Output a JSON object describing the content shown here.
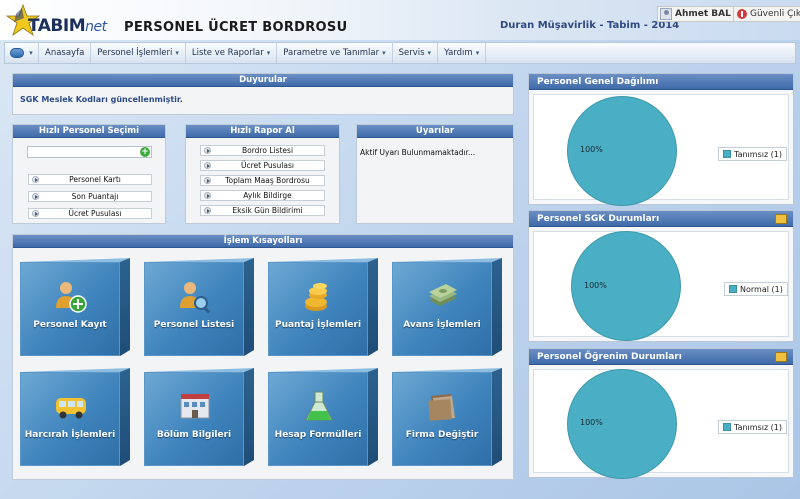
{
  "header": {
    "logo_main": "TABIM",
    "logo_suffix": "net",
    "app_title": "PERSONEL ÜCRET BORDROSU",
    "company": "Duran Müşavirlik - Tabim - 2014",
    "user_name": "Ahmet BAL",
    "logout_label": "Güvenli Çıkış"
  },
  "menu": {
    "items": [
      {
        "label": "Anasayfa",
        "has_caret": false
      },
      {
        "label": "Personel İşlemleri",
        "has_caret": true
      },
      {
        "label": "Liste ve Raporlar",
        "has_caret": true
      },
      {
        "label": "Parametre ve Tanımlar",
        "has_caret": true
      },
      {
        "label": "Servis",
        "has_caret": true
      },
      {
        "label": "Yardım",
        "has_caret": true
      }
    ]
  },
  "announcements": {
    "title": "Duyurular",
    "text": "SGK Meslek Kodları güncellenmiştir."
  },
  "quick_personnel": {
    "title": "Hızlı Personel Seçimi",
    "search_value": "",
    "links": [
      "Personel Kartı",
      "Son Puantajı",
      "Ücret Pusulası"
    ]
  },
  "quick_report": {
    "title": "Hızlı Rapor Al",
    "links": [
      "Bordro Listesi",
      "Ücret Pusulası",
      "Toplam Maaş Bordrosu",
      "Aylık Bildirge",
      "Eksik Gün Bildirimi"
    ]
  },
  "warnings": {
    "title": "Uyarılar",
    "text": "Aktif Uyarı Bulunmamaktadır..."
  },
  "shortcuts": {
    "title": "İşlem Kısayolları",
    "tiles": [
      {
        "label": "Personel Kayıt",
        "icon": "add-user-icon"
      },
      {
        "label": "Personel Listesi",
        "icon": "user-search-icon"
      },
      {
        "label": "Puantaj İşlemleri",
        "icon": "coins-icon"
      },
      {
        "label": "Avans İşlemleri",
        "icon": "money-icon"
      },
      {
        "label": "Harcırah İşlemleri",
        "icon": "van-icon"
      },
      {
        "label": "Bölüm Bilgileri",
        "icon": "building-icon"
      },
      {
        "label": "Hesap Formülleri",
        "icon": "flask-icon"
      },
      {
        "label": "Firma Değiştir",
        "icon": "folder-icon"
      }
    ]
  },
  "charts": {
    "general": {
      "title": "Personel Genel Dağılımı",
      "slice_label": "100%",
      "legend": "Tanımsız (1)"
    },
    "sgk": {
      "title": "Personel SGK Durumları",
      "slice_label": "100%",
      "legend": "Normal (1)"
    },
    "education": {
      "title": "Personel Öğrenim Durumları",
      "slice_label": "100%",
      "legend": "Tanımsız (1)"
    }
  },
  "chart_data": [
    {
      "type": "pie",
      "title": "Personel Genel Dağılımı",
      "categories": [
        "Tanımsız"
      ],
      "values": [
        1
      ],
      "labels": [
        "100%"
      ],
      "color": "#4aafc4",
      "legend": "right"
    },
    {
      "type": "pie",
      "title": "Personel SGK Durumları",
      "categories": [
        "Normal"
      ],
      "values": [
        1
      ],
      "labels": [
        "100%"
      ],
      "color": "#4aafc4",
      "legend": "right"
    },
    {
      "type": "pie",
      "title": "Personel Öğrenim Durumları",
      "categories": [
        "Tanımsız"
      ],
      "values": [
        1
      ],
      "labels": [
        "100%"
      ],
      "color": "#4aafc4",
      "legend": "right"
    }
  ],
  "colors": {
    "panel_header": "#4a74b3",
    "accent_teal": "#4aafc4",
    "tile_blue": "#3f84bd"
  }
}
